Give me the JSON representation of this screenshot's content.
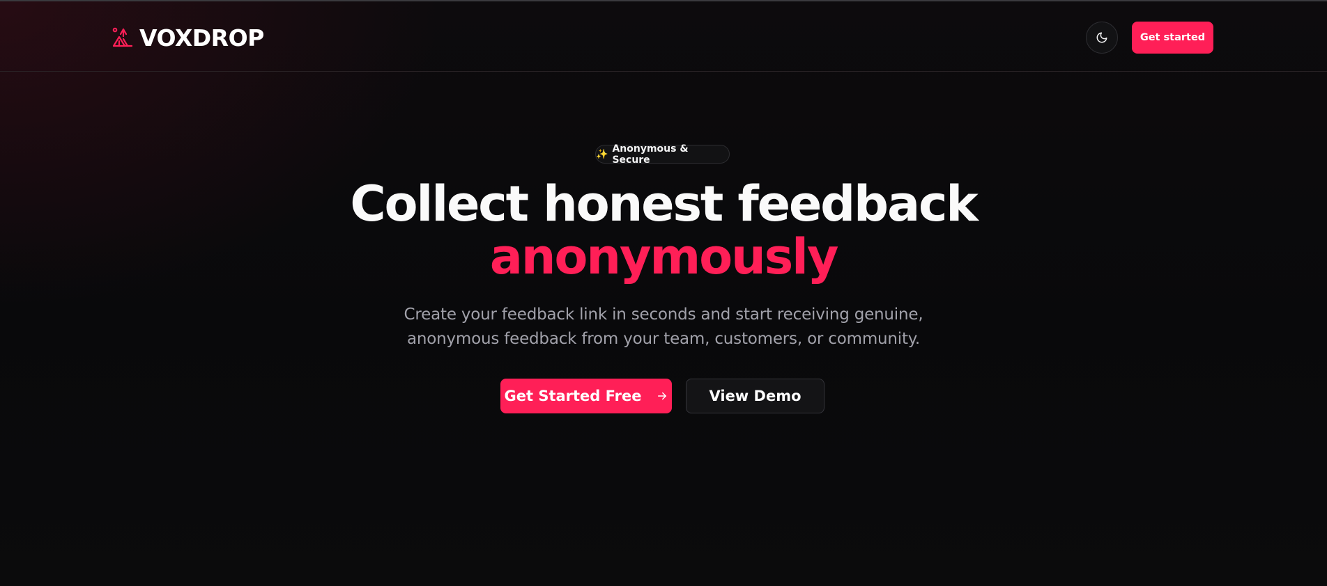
{
  "header": {
    "brand_name": "VOXDROP",
    "brand_icon": "campsite-icon",
    "theme_toggle_icon": "moon-icon",
    "cta_label": "Get started"
  },
  "hero": {
    "badge": {
      "icon": "sparkles-icon",
      "label": "Anonymous & Secure"
    },
    "headline_line1": "Collect honest feedback",
    "headline_line2": "anonymously",
    "subtitle_line1": "Create your feedback link in seconds and start receiving genuine,",
    "subtitle_line2": "anonymous feedback from your team, customers, or community.",
    "primary_cta": {
      "label": "Get Started Free",
      "icon": "arrow-right-icon"
    },
    "secondary_cta": {
      "label": "View Demo"
    }
  },
  "colors": {
    "accent": "#ff1f57",
    "background": "#0a0a0c",
    "muted_text": "#a1a1aa"
  }
}
